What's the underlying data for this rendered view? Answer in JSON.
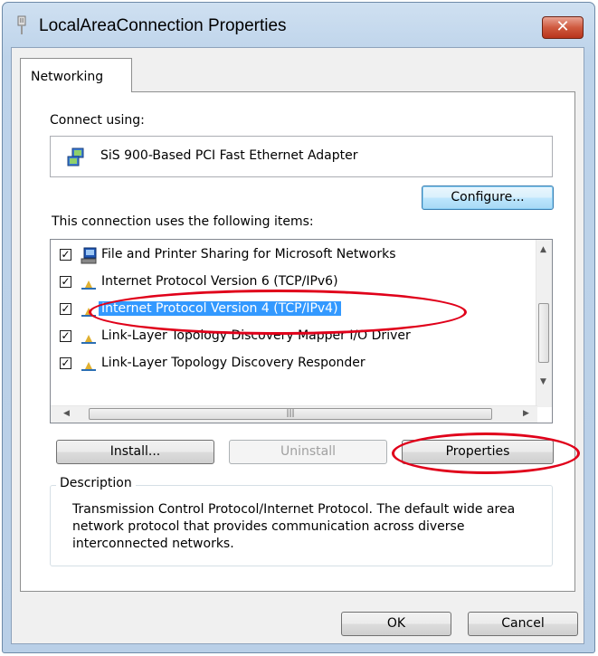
{
  "window": {
    "title": "LocalAreaConnection Properties",
    "close_label": "✕"
  },
  "tabs": [
    {
      "label": "Networking",
      "selected": true
    }
  ],
  "connect_using": {
    "label": "Connect using:",
    "adapter": "SiS 900-Based PCI Fast Ethernet Adapter",
    "configure_button": "Configure..."
  },
  "items_section": {
    "label": "This connection uses the following items:",
    "items": [
      {
        "label": "File and Printer Sharing for Microsoft Networks",
        "checked": true,
        "icon": "network-computer-icon",
        "selected": false
      },
      {
        "label": "Internet Protocol Version 6 (TCP/IPv6)",
        "checked": true,
        "icon": "protocol-icon",
        "selected": false
      },
      {
        "label": "Internet Protocol Version 4 (TCP/IPv4)",
        "checked": true,
        "icon": "protocol-icon",
        "selected": true
      },
      {
        "label": "Link-Layer Topology Discovery Mapper I/O Driver",
        "checked": true,
        "icon": "protocol-icon",
        "selected": false
      },
      {
        "label": "Link-Layer Topology Discovery Responder",
        "checked": true,
        "icon": "protocol-icon",
        "selected": false
      }
    ]
  },
  "buttons": {
    "install": "Install...",
    "uninstall": "Uninstall",
    "properties": "Properties",
    "ok": "OK",
    "cancel": "Cancel"
  },
  "description": {
    "legend": "Description",
    "text": "Transmission Control Protocol/Internet Protocol. The default wide area network protocol that provides communication across diverse interconnected networks."
  },
  "colors": {
    "highlight_annotation": "#e0001a",
    "selection": "#3399ff"
  }
}
